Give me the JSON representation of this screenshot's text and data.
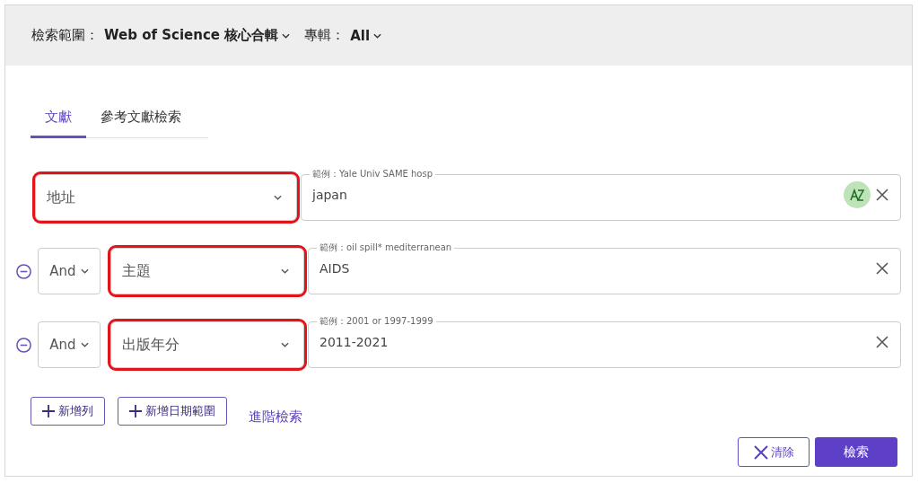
{
  "scope_bar": {
    "scope_label": "檢索範圍：",
    "scope_value": "Web of Science 核心合輯",
    "edition_label": "專輯：",
    "edition_value": "All"
  },
  "tabs": [
    {
      "label": "文獻",
      "selected": true
    },
    {
      "label": "參考文獻檢索",
      "selected": false
    }
  ],
  "rows": [
    {
      "operator": null,
      "field": "地址",
      "highlighted": true,
      "hint": "範例：Yale Univ SAME hosp",
      "value": "japan",
      "az_toggle": true
    },
    {
      "operator": "And",
      "field": "主題",
      "highlighted": true,
      "hint": "範例：oil spill* mediterranean",
      "value": "AIDS",
      "az_toggle": false
    },
    {
      "operator": "And",
      "field": "出版年分",
      "highlighted": true,
      "hint": "範例：2001 or 1997-1999",
      "value": "2011-2021",
      "az_toggle": false
    }
  ],
  "add_buttons": [
    "新增列",
    "新增日期範圍"
  ],
  "advanced_link": "進階檢索",
  "clear_button": "清除",
  "search_button": "檢索"
}
